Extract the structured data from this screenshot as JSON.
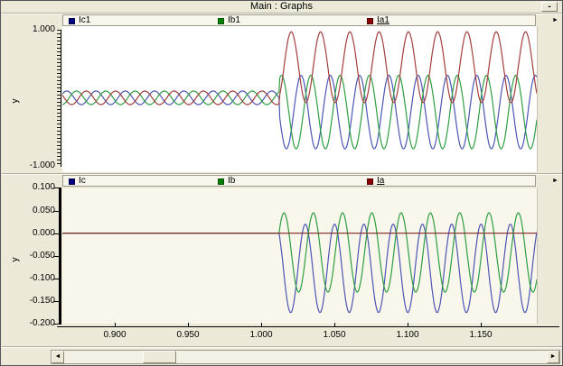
{
  "window": {
    "title": "Main : Graphs",
    "minimize_label": "-"
  },
  "icons": {
    "panel_arrow": "►",
    "scroll_left": "◄",
    "scroll_right": "►"
  },
  "signal": {
    "frequency_hz": 50,
    "fault_time_s": 1.012,
    "t_min_s": 0.864,
    "t_max_s": 1.188
  },
  "xaxis": {
    "tick_labels": [
      {
        "label": "0.900",
        "t": 0.9
      },
      {
        "label": "0.950",
        "t": 0.95
      },
      {
        "label": "1.000",
        "t": 1.0
      },
      {
        "label": "1.050",
        "t": 1.05
      },
      {
        "label": "1.100",
        "t": 1.1
      },
      {
        "label": "1.150",
        "t": 1.15
      }
    ]
  },
  "chart_data": [
    {
      "id": "top-graph",
      "type": "line",
      "ylabel": "y",
      "ylim": [
        -1.0,
        1.0
      ],
      "grid": false,
      "legend_position": "top",
      "ytick_labels": [
        {
          "label": "1.000",
          "value": 1.0
        },
        {
          "label": "-1.000",
          "value": -1.0
        }
      ],
      "series": [
        {
          "name": "Ic1",
          "curve_color": "#4c56b4",
          "legend_color": "#000080",
          "underline": false,
          "model": {
            "pre": {
              "offset": 0,
              "amplitude": 0.1,
              "phase": -3.141
            },
            "post": {
              "offset": -0.21,
              "amplitude": 0.54,
              "phase": -3.141
            }
          }
        },
        {
          "name": "Ib1",
          "curve_color": "#2f9e41",
          "legend_color": "#008000",
          "underline": false,
          "model": {
            "pre": {
              "offset": 0,
              "amplitude": 0.1,
              "phase": 1.047
            },
            "post": {
              "offset": -0.21,
              "amplitude": 0.54,
              "phase": 1.047
            }
          }
        },
        {
          "name": "Ia1",
          "curve_color": "#a23e3e",
          "legend_color": "#8b0000",
          "underline": true,
          "model": {
            "pre": {
              "offset": 0,
              "amplitude": 0.1,
              "phase": -1.047
            },
            "post": {
              "offset": 0.45,
              "amplitude": 0.52,
              "phase": -1.047
            }
          }
        }
      ]
    },
    {
      "id": "bottom-graph",
      "type": "line",
      "ylabel": "y",
      "ylim": [
        -0.2,
        0.1
      ],
      "grid": false,
      "legend_position": "top",
      "ytick_labels": [
        {
          "label": "0.100",
          "value": 0.1
        },
        {
          "label": "0.050",
          "value": 0.05
        },
        {
          "label": "0.000",
          "value": 0.0
        },
        {
          "label": "-0.050",
          "value": -0.05
        },
        {
          "label": "-0.100",
          "value": -0.1
        },
        {
          "label": "-0.150",
          "value": -0.15
        },
        {
          "label": "-0.200",
          "value": -0.2
        }
      ],
      "series": [
        {
          "name": "Ic",
          "curve_color": "#4c56b4",
          "legend_color": "#000080",
          "underline": false,
          "model": {
            "pre": {
              "offset": 0,
              "amplitude": 0,
              "phase": 0
            },
            "post": {
              "offset": -0.0775,
              "amplitude": 0.0975,
              "phase": 2.22
            }
          }
        },
        {
          "name": "Ib",
          "curve_color": "#2f9e41",
          "legend_color": "#008000",
          "underline": false,
          "model": {
            "pre": {
              "offset": 0,
              "amplitude": 0,
              "phase": 0
            },
            "post": {
              "offset": -0.0425,
              "amplitude": 0.0875,
              "phase": 0.51
            }
          }
        },
        {
          "name": "Ia",
          "curve_color": "#7e2222",
          "legend_color": "#8b0000",
          "underline": true,
          "model": {
            "pre": {
              "offset": 0,
              "amplitude": 0,
              "phase": 0
            },
            "post": {
              "offset": 0,
              "amplitude": 0,
              "phase": 0
            }
          }
        }
      ]
    }
  ]
}
